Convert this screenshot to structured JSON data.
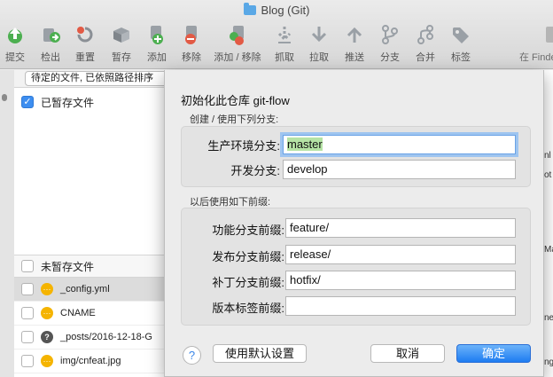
{
  "window": {
    "title": "Blog (Git)"
  },
  "toolbar": {
    "items": [
      {
        "label": "提交",
        "icon": "commit-icon"
      },
      {
        "label": "检出",
        "icon": "checkout-icon"
      },
      {
        "label": "重置",
        "icon": "reset-icon"
      },
      {
        "label": "暂存",
        "icon": "stash-icon"
      },
      {
        "label": "添加",
        "icon": "add-icon"
      },
      {
        "label": "移除",
        "icon": "remove-icon"
      },
      {
        "label": "添加 / 移除",
        "icon": "add-remove-icon"
      },
      {
        "label": "抓取",
        "icon": "fetch-icon"
      },
      {
        "label": "拉取",
        "icon": "pull-icon"
      },
      {
        "label": "推送",
        "icon": "push-icon"
      },
      {
        "label": "分支",
        "icon": "branch-icon"
      },
      {
        "label": "合并",
        "icon": "merge-icon"
      },
      {
        "label": "标签",
        "icon": "tag-icon"
      },
      {
        "label": "在 Finde",
        "icon": "finder-icon"
      }
    ]
  },
  "file_panel": {
    "sort_select": "待定的文件, 已依照路径排序",
    "staged_header": "已暂存文件",
    "unstaged_header": "未暂存文件",
    "files": [
      {
        "name": "_config.yml",
        "status": "modified"
      },
      {
        "name": "CNAME",
        "status": "modified"
      },
      {
        "name": "_posts/2016-12-18-G",
        "status": "unknown"
      },
      {
        "name": "img/cnfeat.jpg",
        "status": "modified"
      }
    ],
    "right_peek": [
      "nl",
      "ot",
      "Ma",
      "ne",
      "ng"
    ]
  },
  "dialog": {
    "title": "初始化此仓库 git-flow",
    "branches_caption": "创建 / 使用下列分支:",
    "production_label": "生产环境分支:",
    "production_value": "master",
    "develop_label": "开发分支:",
    "develop_value": "develop",
    "prefix_caption": "以后使用如下前缀:",
    "feature_label": "功能分支前缀:",
    "feature_value": "feature/",
    "release_label": "发布分支前缀:",
    "release_value": "release/",
    "hotfix_label": "补丁分支前缀:",
    "hotfix_value": "hotfix/",
    "version_label": "版本标签前缀:",
    "version_value": "",
    "help_label": "?",
    "defaults_button": "使用默认设置",
    "cancel_button": "取消",
    "ok_button": "确定"
  },
  "colors": {
    "accent": "#1e7cf1",
    "highlight": "#b5e3a5",
    "icon_green": "#4caf50",
    "icon_red": "#e25a45"
  }
}
